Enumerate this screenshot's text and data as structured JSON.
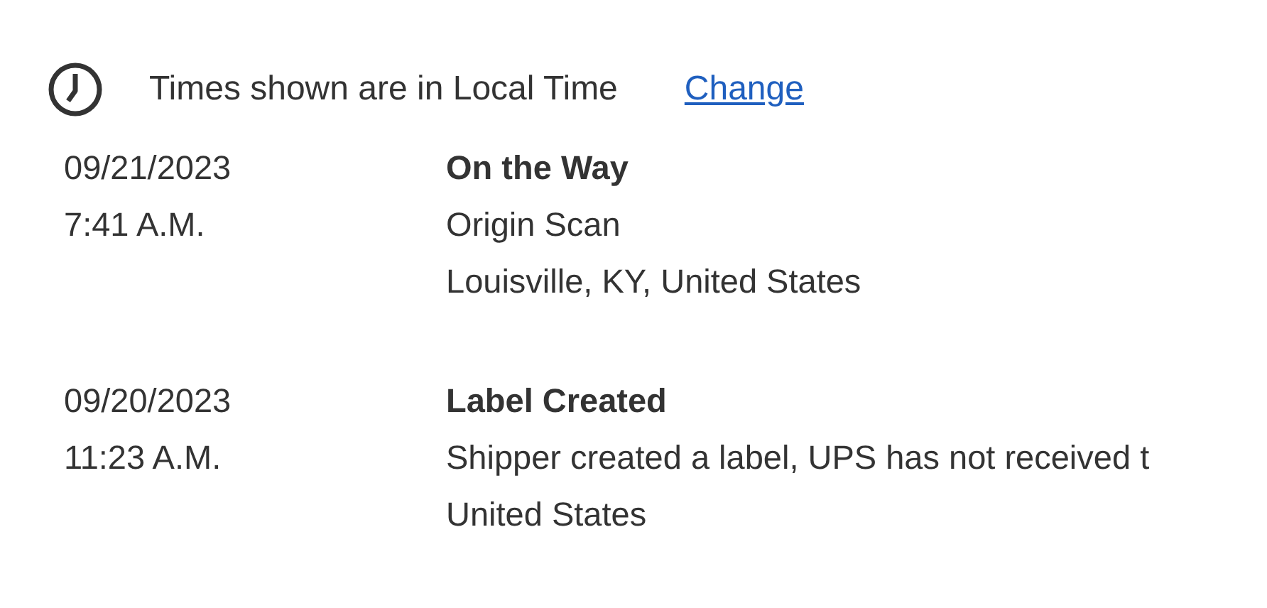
{
  "timezone": {
    "notice": "Times shown are in Local Time",
    "link": "Change"
  },
  "events": [
    {
      "date": "09/21/2023",
      "time": "7:41 A.M.",
      "status": "On the Way",
      "description": "Origin Scan",
      "location": "Louisville, KY, United States"
    },
    {
      "date": "09/20/2023",
      "time": "11:23 A.M.",
      "status": "Label Created",
      "description": "Shipper created a label, UPS has not received t",
      "location": "United States"
    }
  ]
}
